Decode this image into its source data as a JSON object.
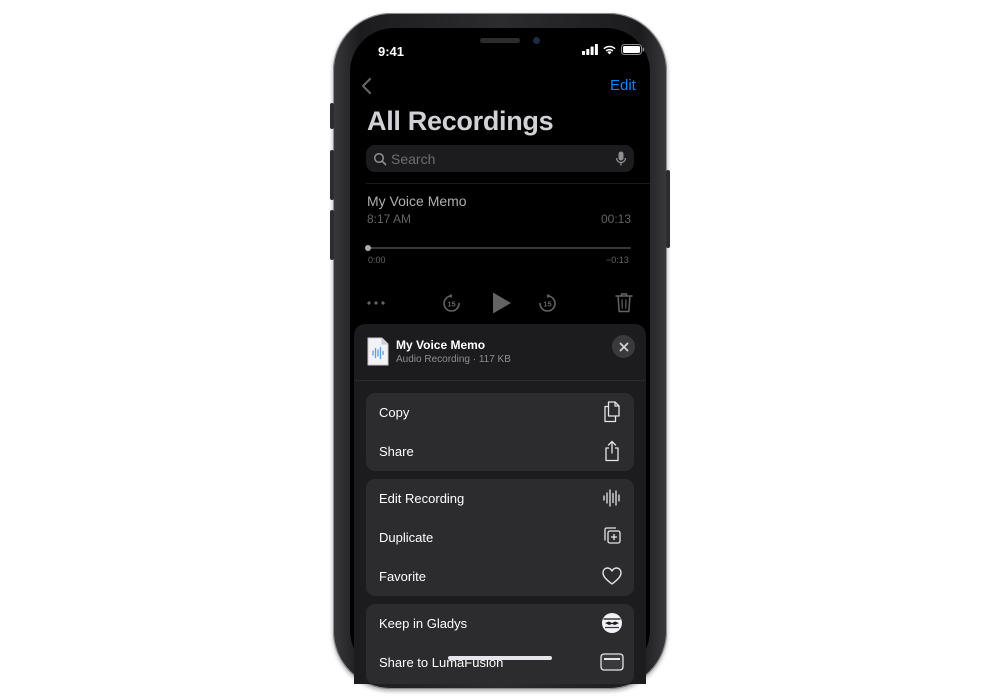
{
  "status_bar": {
    "time": "9:41"
  },
  "header": {
    "edit_label": "Edit",
    "title": "All Recordings"
  },
  "search": {
    "placeholder": "Search"
  },
  "recording": {
    "name": "My Voice Memo",
    "time": "8:17 AM",
    "duration": "00:13",
    "elapsed": "0:00",
    "remaining": "−0:13",
    "progress": 0
  },
  "share_sheet": {
    "title": "My Voice Memo",
    "subtitle": "Audio Recording · 117 KB",
    "groups": [
      {
        "actions": [
          {
            "label": "Copy",
            "icon": "copy-icon"
          },
          {
            "label": "Share",
            "icon": "share-icon"
          }
        ]
      },
      {
        "actions": [
          {
            "label": "Edit Recording",
            "icon": "waveform-icon"
          },
          {
            "label": "Duplicate",
            "icon": "duplicate-icon"
          },
          {
            "label": "Favorite",
            "icon": "heart-icon"
          }
        ]
      },
      {
        "actions": [
          {
            "label": "Keep in Gladys",
            "icon": "gladys-icon"
          },
          {
            "label": "Share to LumaFusion",
            "icon": "lumafusion-icon"
          }
        ]
      }
    ]
  },
  "colors": {
    "accent": "#0a84ff",
    "background": "#000000",
    "sheet": "#1c1c1e",
    "group": "#2c2c2e"
  }
}
